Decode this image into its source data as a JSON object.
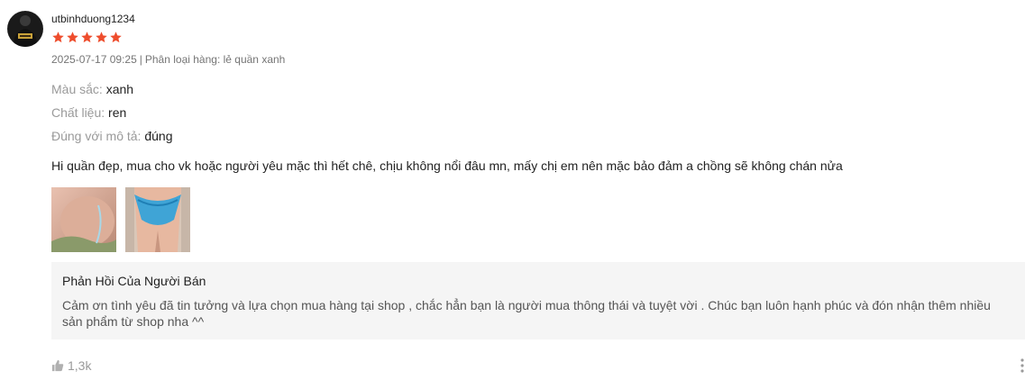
{
  "review": {
    "username": "utbinhduong1234",
    "rating": 5,
    "date": "2025-07-17 09:25",
    "separator": "|",
    "variation": "Phân loại hàng: lẻ quần xanh",
    "attributes": [
      {
        "key": "Màu sắc:",
        "value": "xanh"
      },
      {
        "key": "Chất liệu:",
        "value": "ren"
      },
      {
        "key": "Đúng với mô tả:",
        "value": "đúng"
      }
    ],
    "comment": "Hi quần đẹp, mua cho vk hoặc người yêu mặc thì hết chê, chịu không nổi đâu mn, mấy chị em nên mặc bảo đảm a chồng sẽ không chán nửa",
    "seller_reply": {
      "title": "Phản Hồi Của Người Bán",
      "text": "Cảm ơn tình yêu đã tin tưởng và lựa chọn mua hàng tại shop , chắc hẳn bạn là người mua thông thái và tuyệt vời . Chúc bạn luôn hạnh phúc và đón nhận thêm nhiều sản phẩm từ shop nha ^^"
    },
    "likes": "1,3k"
  },
  "icons": {
    "star": "star-icon",
    "like": "thumbs-up-icon",
    "more": "more-vertical-icon"
  },
  "colors": {
    "star": "#ee4d2d",
    "muted": "#757575",
    "reply_bg": "#f5f5f5"
  }
}
